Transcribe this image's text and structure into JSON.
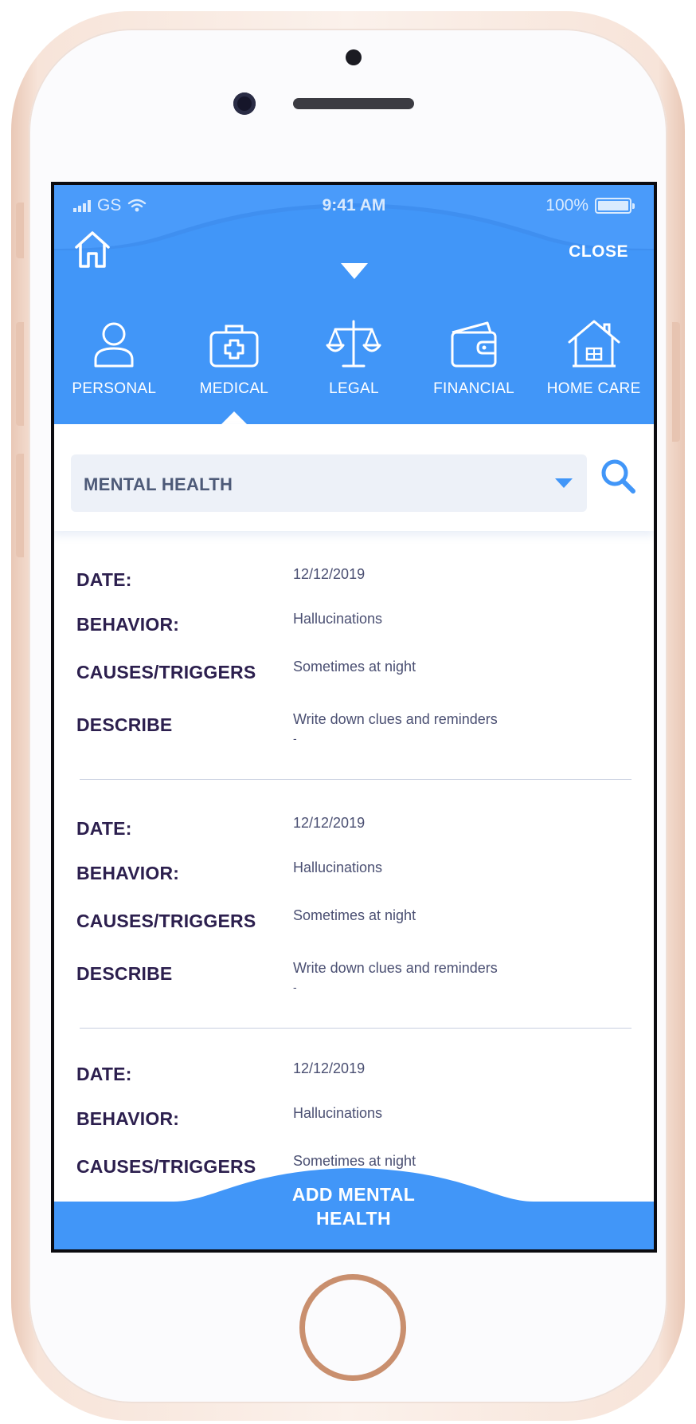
{
  "status_bar": {
    "carrier": "GS",
    "time": "9:41 AM",
    "battery": "100%"
  },
  "header": {
    "close_label": "CLOSE"
  },
  "categories": [
    {
      "label": "PERSONAL",
      "icon": "person-icon"
    },
    {
      "label": "MEDICAL",
      "icon": "medical-kit-icon",
      "active": true
    },
    {
      "label": "LEGAL",
      "icon": "scales-icon"
    },
    {
      "label": "FINANCIAL",
      "icon": "wallet-icon"
    },
    {
      "label": "HOME CARE",
      "icon": "house-icon"
    }
  ],
  "filter": {
    "selected": "MENTAL HEALTH"
  },
  "records": [
    {
      "date_label": "DATE:",
      "date": "12/12/2019",
      "behavior_label": "BEHAVIOR:",
      "behavior": "Hallucinations",
      "causes_label": "CAUSES/TRIGGERS",
      "causes": "Sometimes at night",
      "describe_label": "DESCRIBE",
      "describe": "Write down clues and reminders",
      "describe_extra": "-"
    },
    {
      "date_label": "DATE:",
      "date": "12/12/2019",
      "behavior_label": "BEHAVIOR:",
      "behavior": "Hallucinations",
      "causes_label": "CAUSES/TRIGGERS",
      "causes": "Sometimes at night",
      "describe_label": "DESCRIBE",
      "describe": "Write down clues and reminders",
      "describe_extra": "-"
    },
    {
      "date_label": "DATE:",
      "date": "12/12/2019",
      "behavior_label": "BEHAVIOR:",
      "behavior": "Hallucinations",
      "causes_label": "CAUSES/TRIGGERS",
      "causes": "Sometimes at night"
    }
  ],
  "footer": {
    "add_label_line1": "ADD MENTAL",
    "add_label_line2": "HEALTH"
  },
  "colors": {
    "primary": "#4196f8",
    "label": "#2c1f4e",
    "value": "#4a4f72",
    "select_bg": "#edf1f8"
  }
}
